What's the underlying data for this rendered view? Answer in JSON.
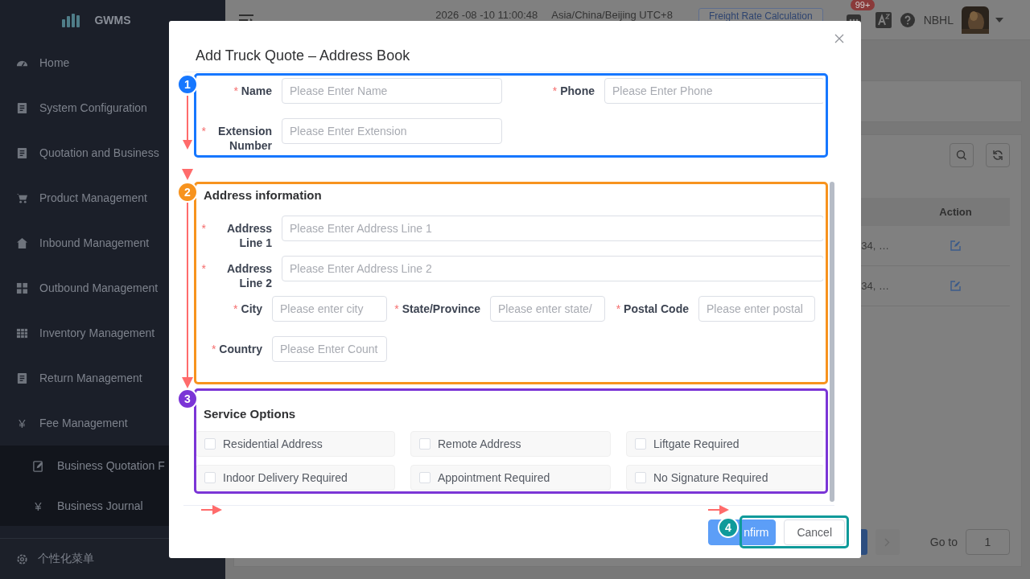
{
  "sidebar": {
    "logo": "GWMS",
    "items": [
      {
        "label": "Home"
      },
      {
        "label": "System Configuration"
      },
      {
        "label": "Quotation and Business"
      },
      {
        "label": "Product Management"
      },
      {
        "label": "Inbound Management"
      },
      {
        "label": "Outbound Management"
      },
      {
        "label": "Inventory Management"
      },
      {
        "label": "Return Management"
      },
      {
        "label": "Fee Management",
        "icon_char": "¥",
        "children": [
          {
            "label": "Business Quotation F"
          },
          {
            "label": "Business Journal",
            "icon_char": "¥"
          }
        ]
      }
    ],
    "footer": "个性化菜单"
  },
  "header": {
    "time": "2026 -08 -10 11:00:48",
    "timezone": "Asia/China/Beijing UTC+8",
    "freight_button": "Freight Rate Calculation",
    "badge": "99+",
    "user": "NBHL"
  },
  "table": {
    "columns": [
      "Action"
    ],
    "rows": [
      {
        "column_1": "34, …"
      },
      {
        "column_1": "34, …"
      }
    ]
  },
  "pagination": {
    "go_to": "Go to",
    "page_input": "1"
  },
  "dialog": {
    "title": "Add Truck Quote – Address Book",
    "contact": [
      [
        {
          "label": "Name",
          "mark": "*",
          "placeholder": "Please Enter Name"
        },
        {
          "label": "Phone",
          "mark": "*",
          "placeholder": "Please Enter Phone"
        }
      ],
      [
        {
          "label": "Extension Number",
          "mark": "*",
          "placeholder": "Please Enter Extension"
        }
      ]
    ],
    "address": {
      "title": "Address information",
      "lines": [
        {
          "label": "Address Line 1",
          "mark": "*",
          "placeholder": "Please Enter Address Line 1"
        },
        {
          "label": "Address Line 2",
          "mark": "*",
          "placeholder": "Please Enter Address Line 2"
        }
      ],
      "details": [
        [
          {
            "label": "City",
            "mark": "*",
            "placeholder": "Please enter city"
          },
          {
            "label": "State/Province",
            "mark": "*",
            "placeholder": "Please enter state/"
          },
          {
            "label": "Postal Code",
            "mark": "*",
            "placeholder": "Please enter postal"
          }
        ],
        [
          {
            "label": "Country",
            "mark": "*",
            "placeholder": "Please Enter Count"
          }
        ]
      ]
    },
    "services": {
      "title": "Service Options",
      "options": [
        {
          "label": "Residential Address",
          "checked": false
        },
        {
          "label": "Remote Address",
          "checked": false
        },
        {
          "label": "Liftgate Required",
          "checked": false
        },
        {
          "label": "Indoor Delivery Required",
          "checked": false
        },
        {
          "label": "Appointment Required",
          "checked": false
        },
        {
          "label": "No Signature Required",
          "checked": false
        }
      ]
    },
    "buttons": [
      {
        "label": "nfirm",
        "kind": "primary"
      },
      {
        "label": "Cancel",
        "kind": "default"
      }
    ]
  },
  "annotations": [
    {
      "label": "1",
      "color": "#1677ff"
    },
    {
      "label": "2",
      "color": "#f7931e"
    },
    {
      "label": "3",
      "color": "#7b35d6"
    },
    {
      "label": "4",
      "color": "#0f9a9a"
    }
  ]
}
